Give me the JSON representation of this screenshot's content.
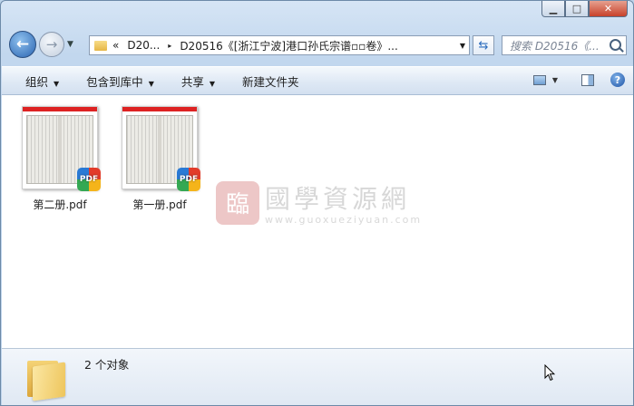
{
  "window": {
    "caption": {
      "minimize": "▁",
      "maximize": "□",
      "close": "✕"
    }
  },
  "nav": {
    "back_icon": "back-arrow-icon",
    "forward_icon": "forward-arrow-icon",
    "back_glyph": "←",
    "forward_glyph": "→",
    "history_glyph": "▼"
  },
  "address": {
    "overflow": "«",
    "parts": [
      "D20...",
      "D20516《[浙江宁波]港口孙氏宗谱▫▫卷》..."
    ],
    "separator": "▸",
    "dropdown": "▼"
  },
  "refresh_glyph": "⇆",
  "search": {
    "placeholder": "搜索 D20516《..."
  },
  "toolbar": {
    "organize": "组织",
    "include_library": "包含到库中",
    "share": "共享",
    "new_folder": "新建文件夹",
    "caret": "▼",
    "help": "?"
  },
  "files": [
    {
      "name": "第二册.pdf",
      "badge": "PDF"
    },
    {
      "name": "第一册.pdf",
      "badge": "PDF"
    }
  ],
  "watermark": {
    "seal": "臨",
    "name": "國學資源網",
    "url": "www.guoxueziyuan.com"
  },
  "status": {
    "count": "2 个对象"
  },
  "colors": {
    "accent": "#2a64b1",
    "pdf_red": "#d22222",
    "close_red": "#c7412a"
  }
}
